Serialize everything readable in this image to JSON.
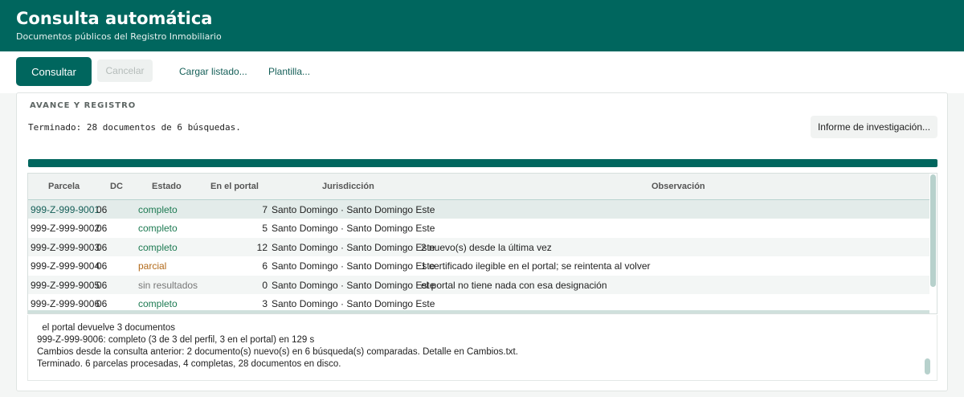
{
  "header": {
    "title": "Consulta automática",
    "subtitle": "Documentos públicos del Registro Inmobiliario"
  },
  "toolbar": {
    "consultar_label": "Consultar",
    "cancelar_label": "Cancelar",
    "cargar_label": "Cargar listado...",
    "plantilla_label": "Plantilla..."
  },
  "panel": {
    "label": "AVANCE Y REGISTRO",
    "status": "Terminado: 28 documentos de 6 búsquedas.",
    "report_button": "Informe de investigación...",
    "progress_fraction": 1.0
  },
  "table": {
    "columns": [
      "Parcela",
      "DC",
      "Estado",
      "En el portal",
      "Jurisdicción",
      "Observación"
    ],
    "rows": [
      {
        "parcela": "999-Z-999-9001",
        "dc": "06",
        "estado": "completo",
        "portal": "7",
        "jurisdiccion": "Santo Domingo · Santo Domingo Este",
        "observacion": ""
      },
      {
        "parcela": "999-Z-999-9002",
        "dc": "06",
        "estado": "completo",
        "portal": "5",
        "jurisdiccion": "Santo Domingo · Santo Domingo Este",
        "observacion": ""
      },
      {
        "parcela": "999-Z-999-9003",
        "dc": "06",
        "estado": "completo",
        "portal": "12",
        "jurisdiccion": "Santo Domingo · Santo Domingo Este",
        "observacion": "2 nuevo(s) desde la última vez"
      },
      {
        "parcela": "999-Z-999-9004",
        "dc": "06",
        "estado": "parcial",
        "portal": "6",
        "jurisdiccion": "Santo Domingo · Santo Domingo Este",
        "observacion": "1 certificado ilegible en el portal; se reintenta al volver"
      },
      {
        "parcela": "999-Z-999-9005",
        "dc": "06",
        "estado": "sin resultados",
        "portal": "0",
        "jurisdiccion": "Santo Domingo · Santo Domingo Este",
        "observacion": "el portal no tiene nada con esa designación"
      },
      {
        "parcela": "999-Z-999-9006",
        "dc": "06",
        "estado": "completo",
        "portal": "3",
        "jurisdiccion": "Santo Domingo · Santo Domingo Este",
        "observacion": ""
      }
    ]
  },
  "log": {
    "lines": [
      "  el portal devuelve 3 documentos",
      "999-Z-999-9006: completo (3 de 3 del perfil, 3 en el portal) en 129 s",
      "Cambios desde la consulta anterior: 2 documento(s) nuevo(s) en 6 búsqueda(s) comparadas. Detalle en Cambios.txt.",
      "Terminado. 6 parcelas procesadas, 4 completas, 28 documentos en disco."
    ]
  },
  "colors": {
    "brand": "#00665e",
    "completo": "#1d7a52",
    "parcial": "#b26a1a",
    "sin_resultados": "#777777"
  }
}
